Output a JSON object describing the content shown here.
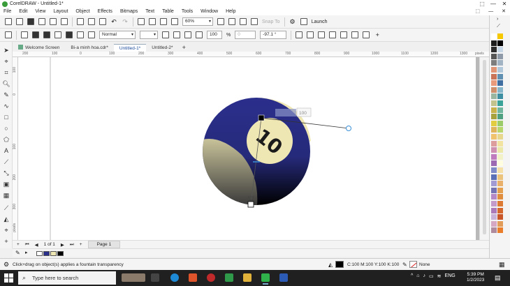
{
  "window": {
    "title": "CorelDRAW - Untitled-1*",
    "controls": [
      "⬚",
      "—",
      "✕"
    ]
  },
  "menu": {
    "items": [
      "File",
      "Edit",
      "View",
      "Layout",
      "Object",
      "Effects",
      "Bitmaps",
      "Text",
      "Table",
      "Tools",
      "Window",
      "Help"
    ],
    "right_icons": [
      "⬚",
      "—",
      "✕"
    ]
  },
  "toolbar1": {
    "zoom": "60%",
    "snap_to": "Snap To",
    "launch": "Launch"
  },
  "toolbar2": {
    "blend_mode": "Normal",
    "opacity": "100",
    "percent": "%",
    "midpoint": "0",
    "angle": "-97.1 °"
  },
  "tabs": [
    {
      "label": "Welcome Screen",
      "active": false
    },
    {
      "label": "Bi-a minh hoa.cdr*",
      "active": false
    },
    {
      "label": "Untitled-1*",
      "active": true
    },
    {
      "label": "Untitled-2*",
      "active": false
    }
  ],
  "rulers": {
    "h_labels": [
      "200",
      "100",
      "0",
      "100",
      "200",
      "300",
      "400",
      "500",
      "600",
      "700",
      "800",
      "900",
      "1000",
      "1100",
      "1200",
      "1300",
      "1400"
    ],
    "h_unit": "pixels",
    "v_labels": [
      "100",
      "0",
      "100",
      "200",
      "300"
    ],
    "v_unit": "pixels"
  },
  "artwork": {
    "ball_number": "10",
    "transparency_value": "100",
    "ball_color": "#2b2f8c",
    "stripe_color": "#efe7b3"
  },
  "pagebar": {
    "page_count": "1 of 1",
    "page_tab": "Page 1"
  },
  "status": {
    "hint": "Click+drag on object(s) applies a fountain transparency",
    "fill": "C:100 M:100 Y:100 K:100",
    "outline": "None"
  },
  "taskbar": {
    "search_placeholder": "Type here to search",
    "lang": "ENG",
    "time": "5:39 PM",
    "date": "1/2/2023"
  },
  "palette": [
    "#ffffff",
    "#f6c800",
    "#1d1d1d",
    "#000000",
    "#2c2c2c",
    "#c7d7e6",
    "#565656",
    "#8f9ba8",
    "#7d7d7d",
    "#a2b4c4",
    "#e09676",
    "#b0c8d9",
    "#c97359",
    "#5f8fb1",
    "#e89a7b",
    "#3f6ea0",
    "#ce8f6a",
    "#87b5c9",
    "#9ab5a0",
    "#3d8fa1",
    "#c3c38d",
    "#3ba29a",
    "#c9b14b",
    "#70b59d",
    "#a7a23d",
    "#4f9f81",
    "#e2cc3f",
    "#9ccc69",
    "#e0b45b",
    "#b7d66b",
    "#f0c46e",
    "#e6d78c",
    "#dd9d9d",
    "#f2e3a0",
    "#cf8fb0",
    "#ece9a8",
    "#c07bbf",
    "#f3f1c6",
    "#9b6ab3",
    "#fffde0",
    "#7e8bc8",
    "#f5e0a8",
    "#5b6fb7",
    "#ecc37d",
    "#a29ad3",
    "#e8b06a",
    "#7673b5",
    "#e4a04f",
    "#b589c5",
    "#e08d3d",
    "#c39ac9",
    "#dc7a34",
    "#ad7ab9",
    "#d4682c",
    "#c9b2d7",
    "#c95626",
    "#d6a7c2",
    "#e29c5a",
    "#b08a9d",
    "#ea7d2a"
  ]
}
